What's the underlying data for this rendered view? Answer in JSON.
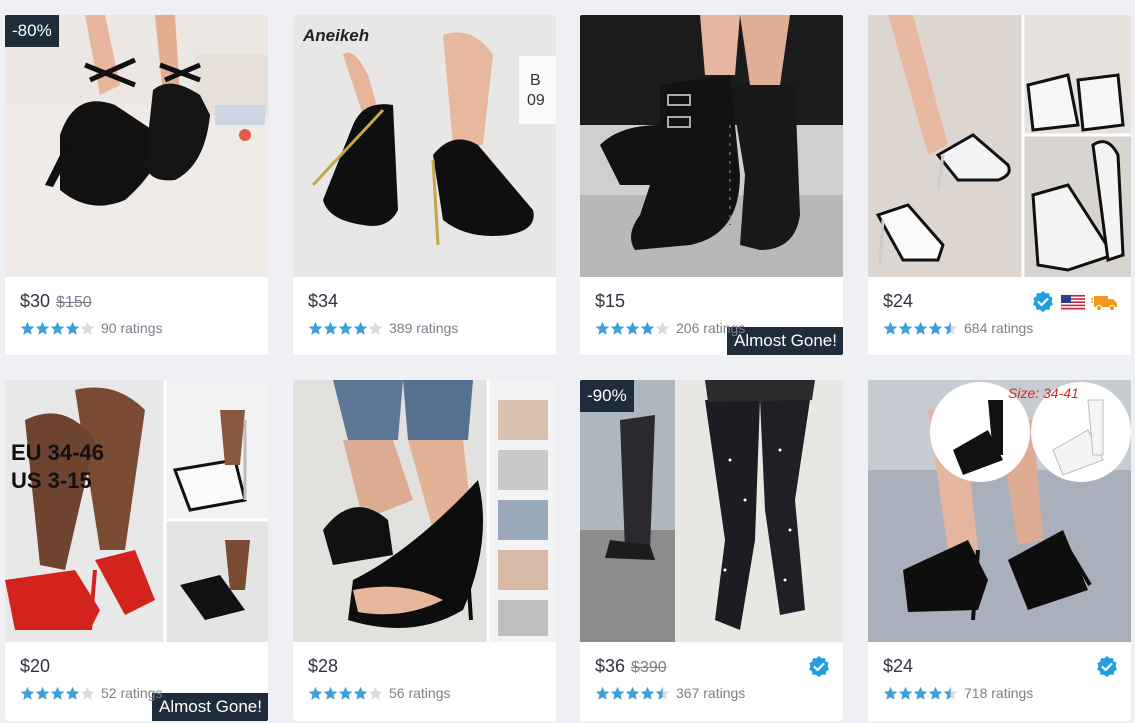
{
  "colors": {
    "accent_blue": "#1e9fe2",
    "star_blue": "#3f9fd8",
    "star_empty": "#d6dbe1",
    "tag_dark": "#1f2d3a",
    "shipping_orange": "#f39a1e"
  },
  "products": [
    {
      "discount": "-80%",
      "price": "$30",
      "old_price": "$150",
      "stars": 4,
      "ratings": "90 ratings",
      "badges": [],
      "image_note": "black suede cross-strap platform pumps",
      "image_caption": ""
    },
    {
      "discount": "",
      "price": "$34",
      "old_price": "",
      "stars": 4,
      "ratings": "389 ratings",
      "badges": [],
      "image_note": "black platform stiletto pumps with gold heel",
      "image_caption": "Aneikeh"
    },
    {
      "discount": "",
      "price": "$15",
      "old_price": "",
      "stars": 4,
      "ratings": "206 ratings",
      "badges": [],
      "image_note": "black buckle lace-up heeled ankle boots",
      "image_caption": "",
      "tag": "Almost Gone!"
    },
    {
      "discount": "",
      "price": "$24",
      "old_price": "",
      "stars": 4.5,
      "ratings": "684 ratings",
      "badges": [
        "verified-icon",
        "us-flag-icon",
        "fast-shipping-icon"
      ],
      "image_note": "white and black platform strappy stilettos collage",
      "image_caption": ""
    },
    {
      "discount": "",
      "price": "$20",
      "old_price": "",
      "stars": 4,
      "ratings": "52 ratings",
      "badges": [],
      "image_note": "red and white platform strappy stilettos collage",
      "image_caption": "EU 34-46\nUS 3-15",
      "tag": "Almost Gone!"
    },
    {
      "discount": "",
      "price": "$28",
      "old_price": "",
      "stars": 4,
      "ratings": "56 ratings",
      "badges": [],
      "image_note": "black peep-toe d'orsay stiletto heels",
      "image_caption": ""
    },
    {
      "discount": "-90%",
      "price": "$36",
      "old_price": "$390",
      "stars": 4.5,
      "ratings": "367 ratings",
      "badges": [
        "verified-icon"
      ],
      "image_note": "rhinestone over-the-knee stiletto boots",
      "image_caption": ""
    },
    {
      "discount": "",
      "price": "$24",
      "old_price": "",
      "stars": 4.5,
      "ratings": "718 ratings",
      "badges": [
        "verified-icon"
      ],
      "image_note": "black platform strappy sandals",
      "image_caption": "Size: 34-41"
    }
  ]
}
